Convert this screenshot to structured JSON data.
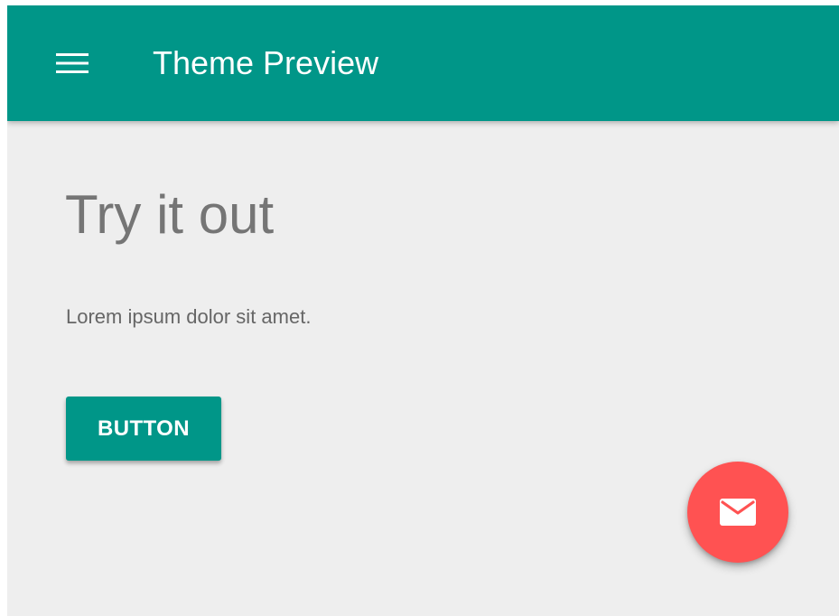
{
  "app_bar": {
    "menu_icon": "menu-icon",
    "title": "Theme Preview",
    "background_color": "#009688",
    "text_color": "#FFFFFF"
  },
  "main": {
    "headline": "Try it out",
    "body_text": "Lorem ipsum dolor sit amet.",
    "button_label": "BUTTON",
    "background_color": "#EEEEEE"
  },
  "floating_action_button": {
    "icon": "mail-icon",
    "color": "#FF5252"
  }
}
